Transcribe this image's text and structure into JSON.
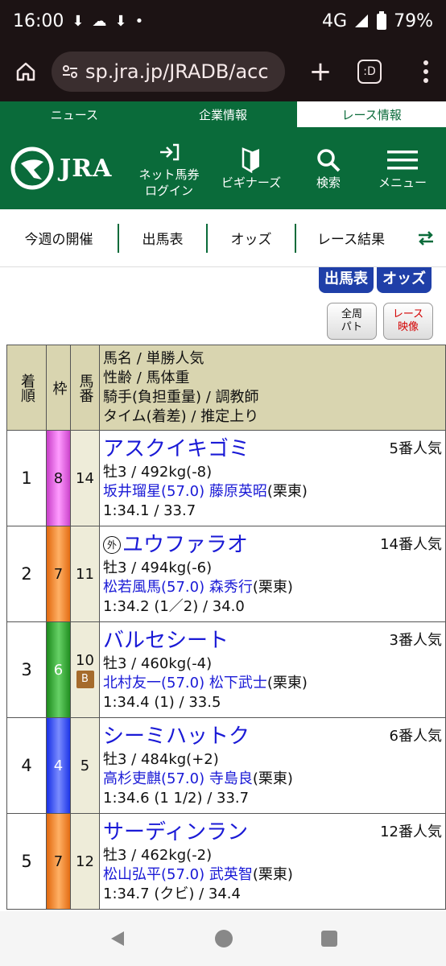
{
  "status": {
    "time": "16:00",
    "network": "4G",
    "battery": "79%"
  },
  "browser": {
    "url": "sp.jra.jp/JRADB/acc",
    "tab_count": ":D"
  },
  "topnav": {
    "items": [
      "ニュース",
      "企業情報",
      "レース情報"
    ],
    "active_index": 2
  },
  "header": {
    "logo_text": "JRA",
    "login_line1": "ネット馬券",
    "login_line2": "ログイン",
    "beginners": "ビギナーズ",
    "search": "検索",
    "menu": "メニュー"
  },
  "subnav": {
    "items": [
      "今週の開催",
      "出馬表",
      "オッズ",
      "レース結果"
    ]
  },
  "cut_buttons": [
    "出馬表",
    "オッズ"
  ],
  "mini_buttons": [
    {
      "line1": "全周",
      "line2": "パト"
    },
    {
      "line1": "レース",
      "line2": "映像"
    }
  ],
  "table": {
    "headers": {
      "rank": "着順",
      "waku": "枠",
      "ban": "馬番",
      "info_line1": "馬名 / 単勝人気",
      "info_line2": "性齢 / 馬体重",
      "info_line3": "騎手(負担重量) / 調教師",
      "info_line4": "タイム(着差) / 推定上り"
    },
    "rows": [
      {
        "rank": "1",
        "waku": "8",
        "ban": "14",
        "horse": "アスクイキゴミ",
        "pop": "5番人気",
        "sex_weight": "牡3 / 492kg(-8)",
        "jockey": "坂井瑠星(57.0)",
        "trainer": "藤原英昭",
        "region": "(栗東)",
        "time": "1:34.1 / 33.7"
      },
      {
        "rank": "2",
        "waku": "7",
        "ban": "11",
        "gai": "外",
        "horse": "ユウファラオ",
        "pop": "14番人気",
        "sex_weight": "牡3 / 494kg(-6)",
        "jockey": "松若風馬(57.0)",
        "trainer": "森秀行",
        "region": "(栗東)",
        "time": "1:34.2 (1／2) / 34.0"
      },
      {
        "rank": "3",
        "waku": "6",
        "ban": "10",
        "badge": "B",
        "horse": "バルセシート",
        "pop": "3番人気",
        "sex_weight": "牡3 / 460kg(-4)",
        "jockey": "北村友一(57.0)",
        "trainer": "松下武士",
        "region": "(栗東)",
        "time": "1:34.4 (1) / 33.5"
      },
      {
        "rank": "4",
        "waku": "4",
        "ban": "5",
        "horse": "シーミハットク",
        "pop": "6番人気",
        "sex_weight": "牡3 / 484kg(+2)",
        "jockey": "高杉吏麒(57.0)",
        "trainer": "寺島良",
        "region": "(栗東)",
        "time": "1:34.6 (1 1/2) / 33.7"
      },
      {
        "rank": "5",
        "waku": "7",
        "ban": "12",
        "horse": "サーディンラン",
        "pop": "12番人気",
        "sex_weight": "牡3 / 462kg(-2)",
        "jockey": "松山弘平(57.0)",
        "trainer": "武英智",
        "region": "(栗東)",
        "time": "1:34.7 (クビ) / 34.4"
      }
    ]
  },
  "colors": {
    "jra_green": "#0a6b3a",
    "link_blue": "#1a1ad6",
    "header_bg": "#d9d5b0"
  }
}
